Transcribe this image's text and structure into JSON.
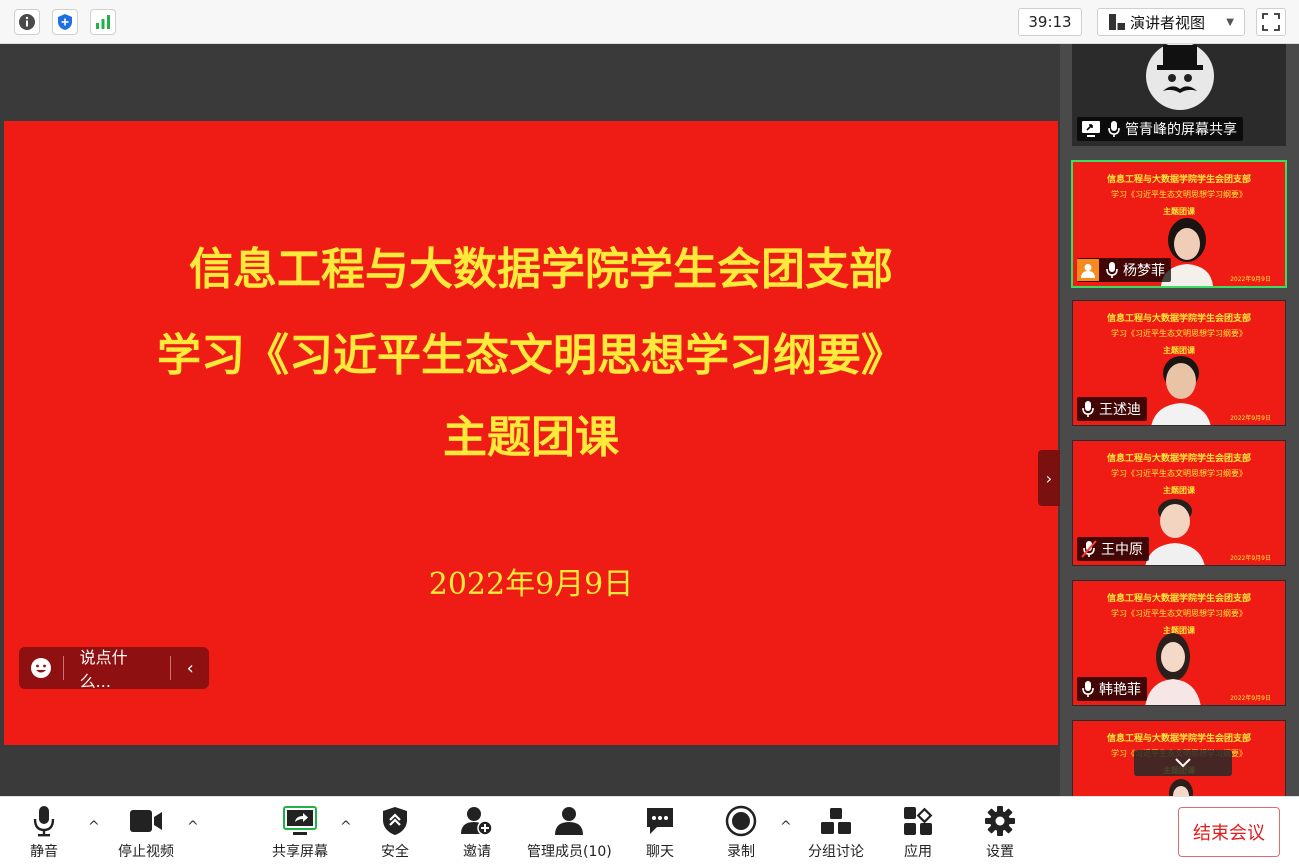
{
  "topbar": {
    "timer": "39:13",
    "view_label": "演讲者视图",
    "view_caret": "▼"
  },
  "slide": {
    "line1": "信息工程与大数据学院学生会团支部",
    "line2": "学习《习近平生态文明思想学习纲要》",
    "line3": "主题团课",
    "date": "2022年9月9日"
  },
  "chat": {
    "placeholder": "说点什么..."
  },
  "gallery": {
    "tiles": [
      {
        "name": "管青峰的屏幕共享"
      },
      {
        "name": "杨梦菲",
        "t1": "信息工程与大数据学院学生会团支部",
        "t2": "学习《习近平生态文明思想学习纲要》",
        "t3": "主题团课",
        "date": "2022年9月9日"
      },
      {
        "name": "王述迪",
        "t1": "信息工程与大数据学院学生会团支部",
        "t2": "学习《习近平生态文明思想学习纲要》",
        "t3": "主题团课",
        "date": "2022年9月9日"
      },
      {
        "name": "王中原",
        "t1": "信息工程与大数据学院学生会团支部",
        "t2": "学习《习近平生态文明思想学习纲要》",
        "t3": "主题团课",
        "date": "2022年9月9日"
      },
      {
        "name": "韩艳菲",
        "t1": "信息工程与大数据学院学生会团支部",
        "t2": "学习《习近平生态文明思想学习纲要》",
        "t3": "主题团课",
        "date": "2022年9月9日"
      },
      {
        "t1": "信息工程与大数据学院学生会团支部",
        "t2": "学习《习近平生态文明思想学习纲要》",
        "t3": "主题团课"
      }
    ]
  },
  "toolbar": {
    "mute": "静音",
    "stop_video": "停止视频",
    "share_screen": "共享屏幕",
    "security": "安全",
    "invite": "邀请",
    "participants": "管理成员(10)",
    "chat": "聊天",
    "record": "录制",
    "breakout": "分组讨论",
    "apps": "应用",
    "settings": "设置",
    "end_meeting": "结束会议"
  },
  "colors": {
    "slide_red": "#ee1c14",
    "slide_text": "#ffe93b",
    "end_red": "#e01c1c",
    "active_border": "#3ddc62"
  }
}
